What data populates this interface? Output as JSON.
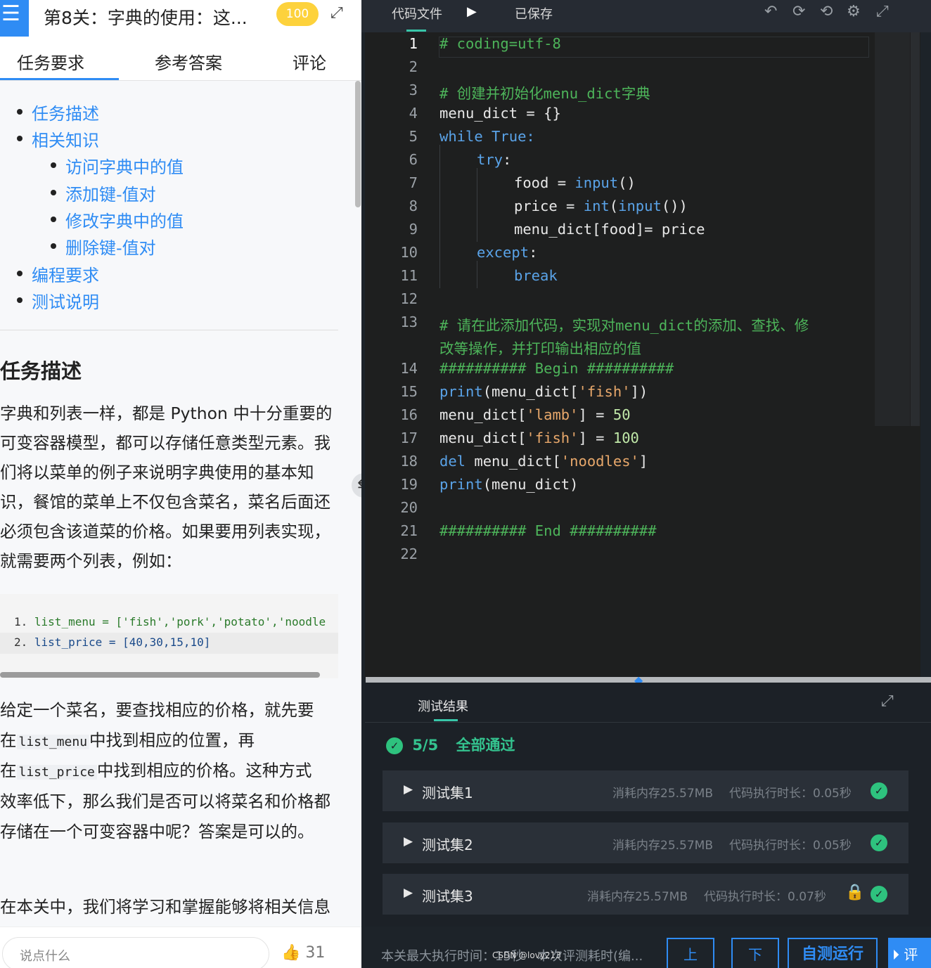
{
  "header": {
    "menu_icon": "menu-icon",
    "title": "第8关：字典的使用：这...",
    "score": "100",
    "expand_icon": "expand-icon"
  },
  "tabs": [
    "任务要求",
    "参考答案",
    "评论"
  ],
  "toc": {
    "items": [
      "任务描述",
      "相关知识",
      "访问字典中的值",
      "添加键-值对",
      "修改字典中的值",
      "删除键-值对",
      "编程要求",
      "测试说明"
    ]
  },
  "content": {
    "heading": "任务描述",
    "para1": [
      "字典和列表一样，都是 Python 中十分重要的",
      "可变容器模型，都可以存储任意类型元素。我",
      "们将以菜单的例子来说明字典使用的基本知",
      "识，餐馆的菜单上不仅包含菜名，菜名后面还",
      "必须包含该道菜的价格。如果要用列表实现，",
      "就需要两个列表，例如："
    ],
    "code_lines": [
      {
        "no": "1.",
        "code": "list_menu = ['fish','pork','potato','noodle"
      },
      {
        "no": "2.",
        "code": "list_price = [40,30,15,10]"
      }
    ],
    "para2_line1": "给定一个菜名，要查找相应的价格，就先要",
    "para2_line2_pre": "在",
    "para2_line2_code": "list_menu",
    "para2_line2_post": "中找到相应的位置，再",
    "para2_line3_pre": "在",
    "para2_line3_code": "list_price",
    "para2_line3_post": "中找到相应的价格。这种方式",
    "para2_line4": "效率低下，那么我们是否可以将菜名和价格都",
    "para2_line5": "存储在一个可变容器中呢？答案是可以的。",
    "para3": "在本关中，我们将学习和掌握能够将相关信息"
  },
  "bottom": {
    "comment_placeholder": "说点什么",
    "likes": "31"
  },
  "editor": {
    "file_label": "代码文件",
    "saved_label": "已保存",
    "line_numbers": [
      "1",
      "2",
      "3",
      "4",
      "5",
      "6",
      "7",
      "8",
      "9",
      "10",
      "11",
      "12",
      "13",
      "14",
      "15",
      "16",
      "17",
      "18",
      "19",
      "20",
      "21",
      "22"
    ],
    "lines": {
      "l1": "# coding=utf-8",
      "l3": "# 创建并初始化menu_dict字典",
      "l4": "menu_dict = {}",
      "l5a": "while",
      "l5b": " True:",
      "l6a": "try",
      "l6b": ":",
      "l7a": "food = ",
      "l7b": "input",
      "l7c": "()",
      "l8a": "price = ",
      "l8b": "int",
      "l8c": "(",
      "l8d": "input",
      "l8e": "())",
      "l9": "menu_dict[food]= price",
      "l10a": "except",
      "l10b": ":",
      "l11": "break",
      "l13a": "# 请在此添加代码，实现对menu_dict的添加、查找、修",
      "l13b": "改等操作，并打印输出相应的值",
      "l14": "########## Begin ##########",
      "l15a": "print",
      "l15b": "(menu_dict[",
      "l15c": "'fish'",
      "l15d": "])",
      "l16a": "menu_dict[",
      "l16b": "'lamb'",
      "l16c": "] = ",
      "l16d": "50",
      "l17a": "menu_dict[",
      "l17b": "'fish'",
      "l17c": "] = ",
      "l17d": "100",
      "l18a": "del",
      "l18b": " menu_dict[",
      "l18c": "'noodles'",
      "l18d": "]",
      "l19a": "print",
      "l19b": "(menu_dict)",
      "l21": "########## End ##########"
    }
  },
  "results": {
    "tab": "测试结果",
    "score": "5/5",
    "status": "全部通过",
    "tests": [
      {
        "name": "测试集1",
        "memory": "消耗内存25.57MB",
        "time": "代码执行时长：0.05秒",
        "locked": false
      },
      {
        "name": "测试集2",
        "memory": "消耗内存25.57MB",
        "time": "代码执行时长：0.05秒",
        "locked": false
      },
      {
        "name": "测试集3",
        "memory": "消耗内存25.57MB",
        "time": "代码执行时长：0.07秒",
        "locked": true
      }
    ]
  },
  "footer": {
    "max_time": "本关最大执行时间：15秒",
    "eval_time": "本次评测耗时(编...",
    "prev": "上",
    "next": "下",
    "run": "自测运行",
    "submit": "评",
    "watermark": "CSDN @lovy213"
  },
  "colors": {
    "accent": "#2f8cf4",
    "pass": "#2ec27e",
    "comment_green": "#4db45a",
    "keyword_blue": "#5aa3e8",
    "string_orange": "#e8a86b"
  }
}
